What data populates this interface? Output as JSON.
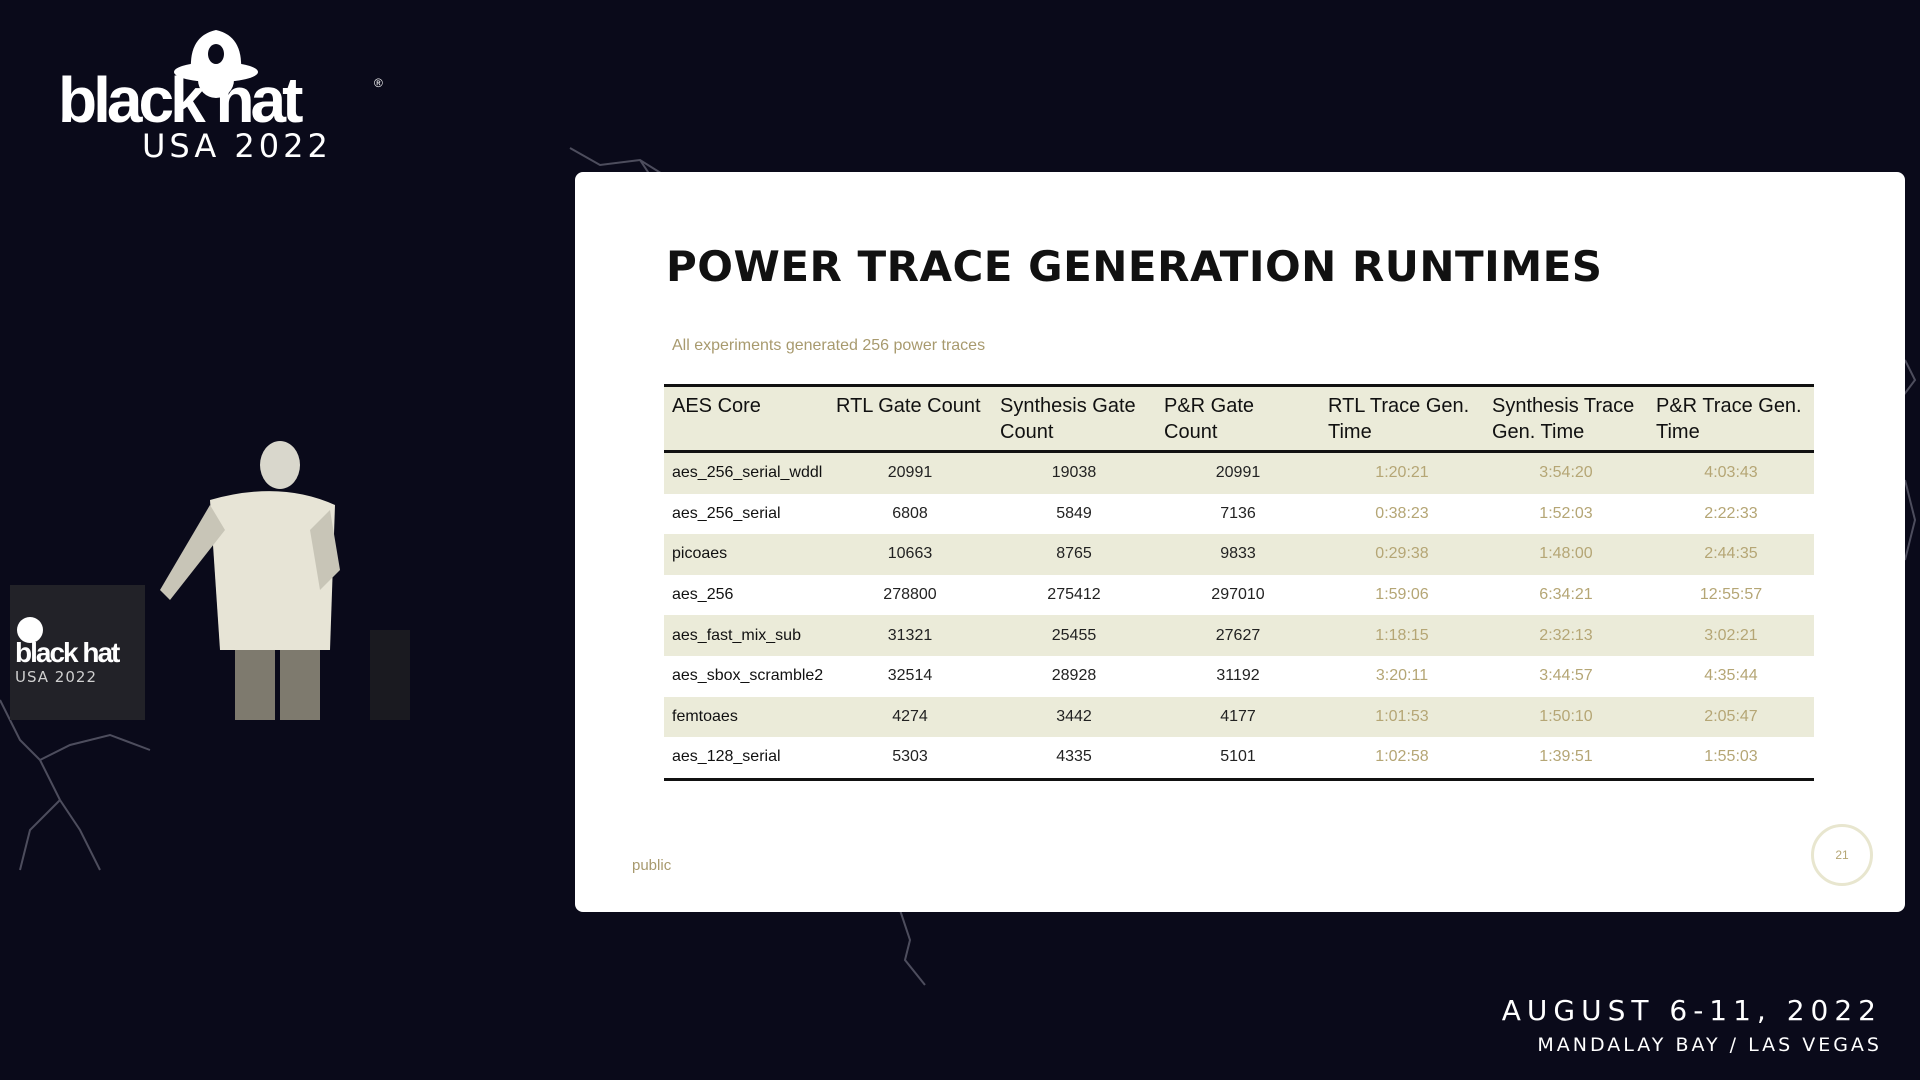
{
  "event": {
    "brand_name": "black hat",
    "registered_mark": "®",
    "edition": "USA 2022",
    "date": "AUGUST 6-11, 2022",
    "venue": "MANDALAY BAY / LAS VEGAS"
  },
  "video": {
    "podium_brand": "black hat",
    "podium_edition": "USA 2022"
  },
  "slide": {
    "title": "POWER TRACE GENERATION RUNTIMES",
    "subtitle": "All experiments generated 256 power traces",
    "footer": "public",
    "page_number": "21",
    "table": {
      "headers": [
        "AES Core",
        "RTL Gate Count",
        "Synthesis Gate Count",
        "P&R Gate Count",
        "RTL Trace Gen. Time",
        "Synthesis Trace Gen. Time",
        "P&R Trace Gen. Time"
      ],
      "rows": [
        [
          "aes_256_serial_wddl",
          "20991",
          "19038",
          "20991",
          "1:20:21",
          "3:54:20",
          "4:03:43"
        ],
        [
          "aes_256_serial",
          "6808",
          "5849",
          "7136",
          "0:38:23",
          "1:52:03",
          "2:22:33"
        ],
        [
          "picoaes",
          "10663",
          "8765",
          "9833",
          "0:29:38",
          "1:48:00",
          "2:44:35"
        ],
        [
          "aes_256",
          "278800",
          "275412",
          "297010",
          "1:59:06",
          "6:34:21",
          "12:55:57"
        ],
        [
          "aes_fast_mix_sub",
          "31321",
          "25455",
          "27627",
          "1:18:15",
          "2:32:13",
          "3:02:21"
        ],
        [
          "aes_sbox_scramble2",
          "32514",
          "28928",
          "31192",
          "3:20:11",
          "3:44:57",
          "4:35:44"
        ],
        [
          "femtoaes",
          "4274",
          "3442",
          "4177",
          "1:01:53",
          "1:50:10",
          "2:05:47"
        ],
        [
          "aes_128_serial",
          "5303",
          "4335",
          "5101",
          "1:02:58",
          "1:39:51",
          "1:55:03"
        ]
      ]
    }
  }
}
